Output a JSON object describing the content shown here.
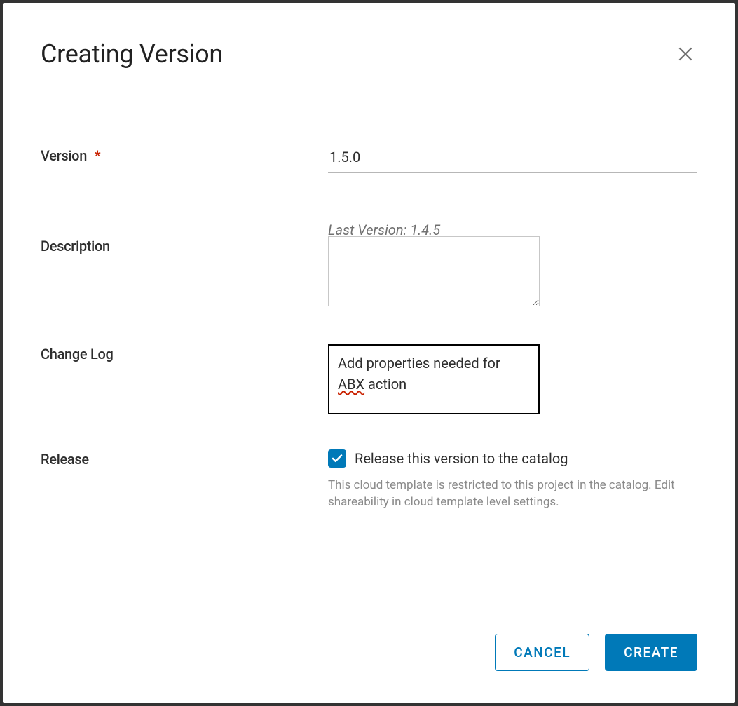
{
  "modal": {
    "title": "Creating Version"
  },
  "form": {
    "version": {
      "label": "Version",
      "value": "1.5.0",
      "required": true,
      "lastVersionLabel": "Last Version: 1.4.5"
    },
    "description": {
      "label": "Description",
      "value": ""
    },
    "changeLog": {
      "label": "Change Log",
      "valuePrefix": "Add properties needed for ",
      "valueSpellcheck": "ABX",
      "valueSuffix": " action"
    },
    "release": {
      "label": "Release",
      "checkboxLabel": "Release this version to the catalog",
      "checked": true,
      "helperText": "This cloud template is restricted to this project in the catalog. Edit shareability in cloud template level settings."
    }
  },
  "buttons": {
    "cancel": "CANCEL",
    "create": "CREATE"
  }
}
